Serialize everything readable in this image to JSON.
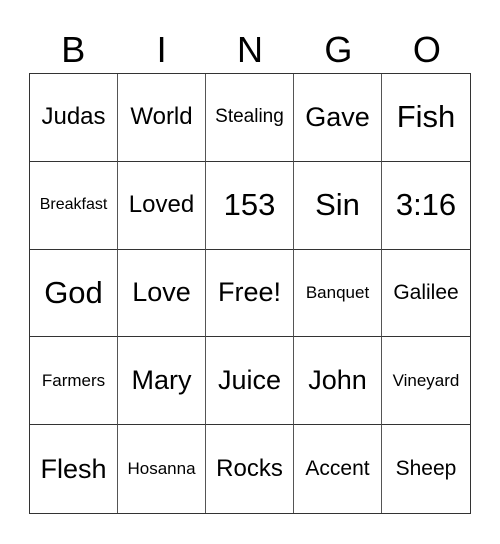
{
  "header": [
    "B",
    "I",
    "N",
    "G",
    "O"
  ],
  "cells": [
    [
      "Judas",
      "World",
      "Stealing",
      "Gave",
      "Fish"
    ],
    [
      "Breakfast",
      "Loved",
      "153",
      "Sin",
      "3:16"
    ],
    [
      "God",
      "Love",
      "Free!",
      "Banquet",
      "Galilee"
    ],
    [
      "Farmers",
      "Mary",
      "Juice",
      "John",
      "Vineyard"
    ],
    [
      "Flesh",
      "Hosanna",
      "Rocks",
      "Accent",
      "Sheep"
    ]
  ]
}
